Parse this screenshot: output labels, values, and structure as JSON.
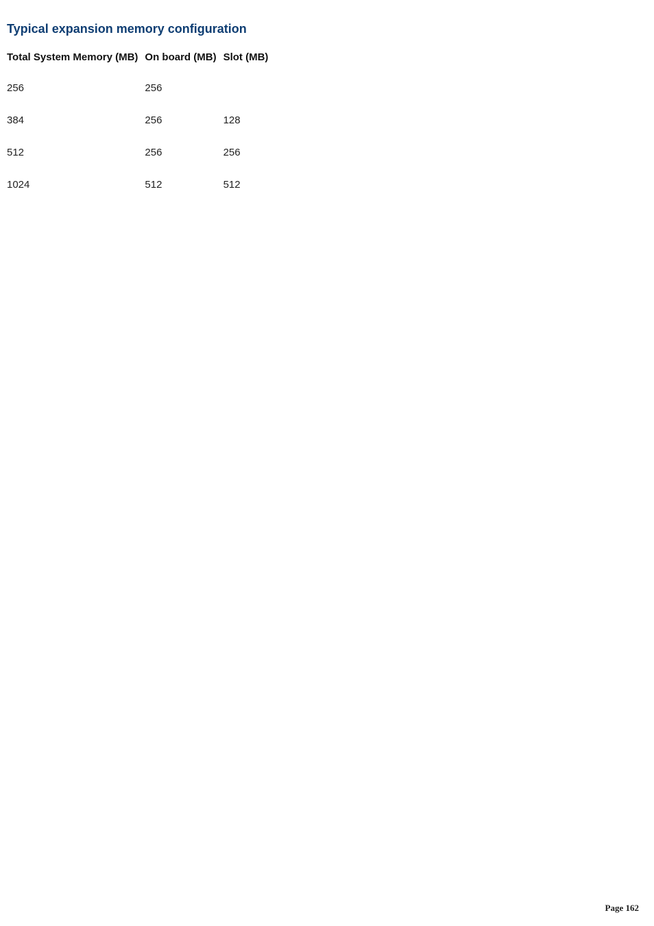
{
  "heading": "Typical expansion memory configuration",
  "table": {
    "headers": [
      "Total System Memory (MB)",
      "On board (MB)",
      "Slot (MB)"
    ],
    "rows": [
      [
        "256",
        "256",
        ""
      ],
      [
        "384",
        "256",
        "128"
      ],
      [
        "512",
        "256",
        "256"
      ],
      [
        "1024",
        "512",
        "512"
      ]
    ]
  },
  "footer": "Page 162"
}
